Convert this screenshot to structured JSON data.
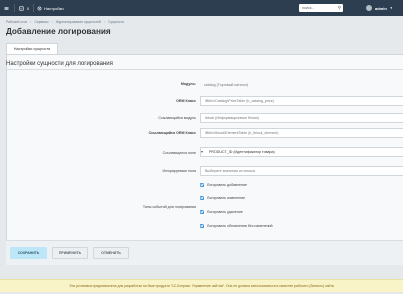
{
  "topbar": {
    "home_label": "",
    "tasks_count": "0",
    "settings_label": "Настройки",
    "search_placeholder": "поиск...",
    "user_name": "admin"
  },
  "breadcrumb": [
    "Рабочий стол",
    "Сервисы",
    "Журналирование сущностей",
    "Сущности"
  ],
  "page": {
    "title": "Добавление логирования"
  },
  "tab": {
    "label": "Настройки сущности"
  },
  "section": {
    "title": "Настройки сущности для логирования"
  },
  "form": {
    "module_label": "Модуль:",
    "module_value": "catalog (Торговый каталог)",
    "orm_label": "ORM Класс",
    "orm_value": "\\Bitrix\\Catalog\\PriceTable (b_catalog_price)",
    "linked_module_label": "Ссылающийся модуль",
    "linked_module_value": "iblock (Информационные блоки)",
    "linked_orm_label": "Ссылающийся ORM Класс",
    "linked_orm_value": "\\Bitrix\\Iblock\\ElementTable (b_iblock_element)",
    "ref_field_label": "Ссылающееся поле",
    "ref_field_value": "PRODUCT_ID (Идентификатор товара)",
    "ignored_label": "Игнорируемые поля",
    "ignored_placeholder": "Выберите значения из списка",
    "event_types_label": "Типы событий для логирования",
    "events": [
      "Логировать добавление",
      "Логировать изменение",
      "Логировать удаление",
      "Логировать обновления без изменений"
    ]
  },
  "buttons": {
    "save": "СОХРАНИТЬ",
    "apply": "ПРИМЕНИТЬ",
    "cancel": "ОТМЕНИТЬ"
  },
  "notice": "Эта установка предназначена для разработки на базе продукта \"1С-Битрикс: Управление сайтом\". Она не должна использоваться в качестве рабочего (боевого) сайта"
}
